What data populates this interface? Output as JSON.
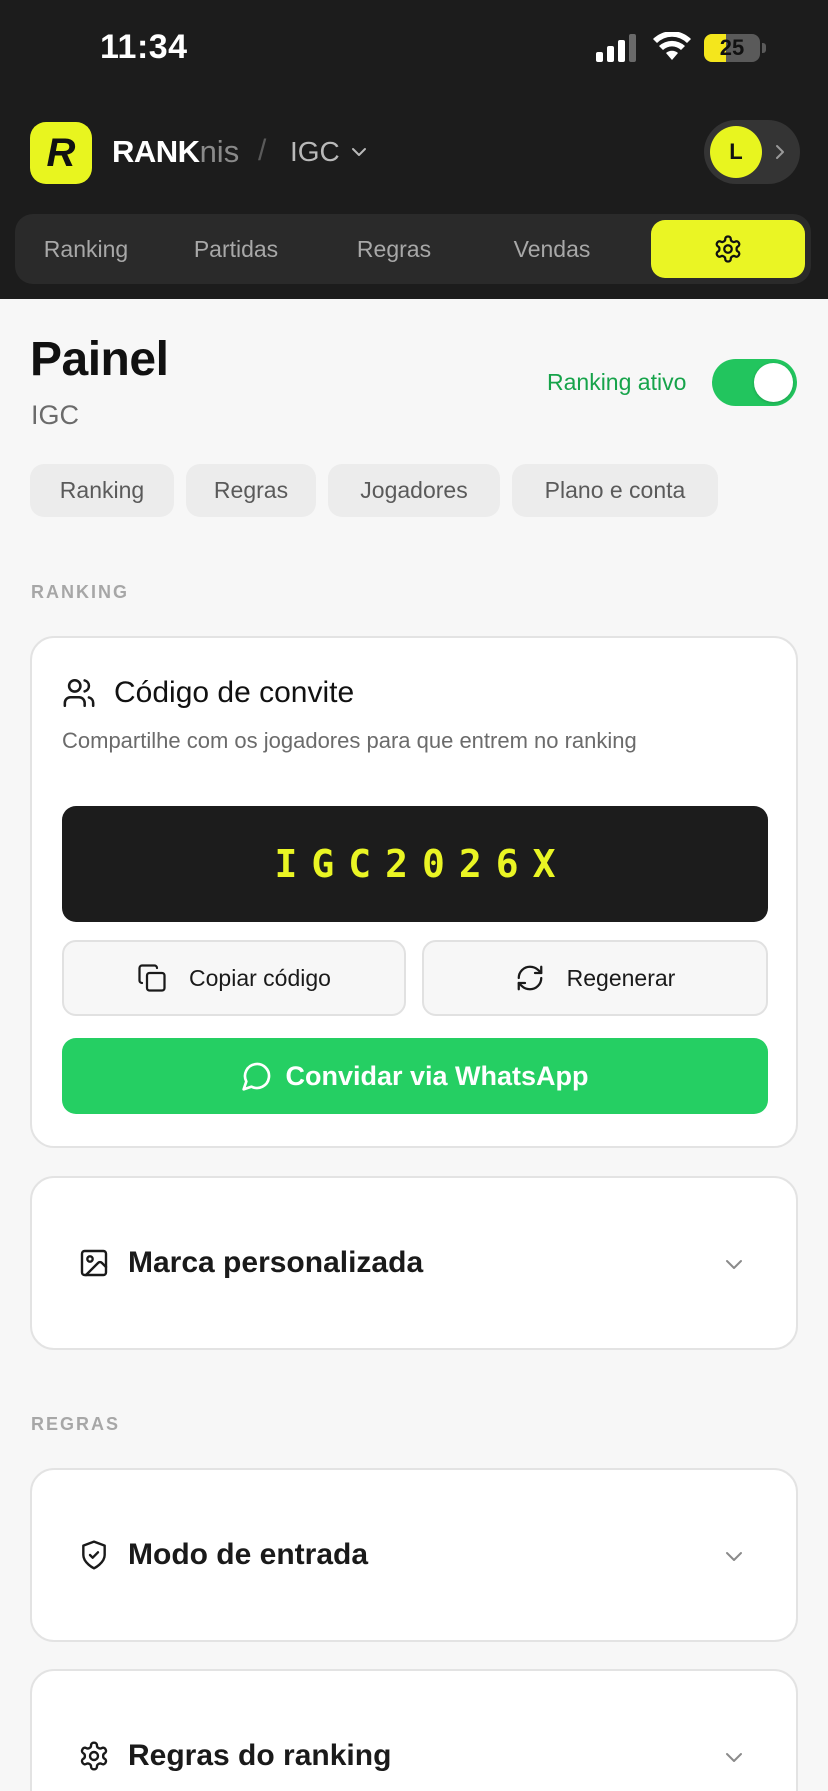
{
  "status_bar": {
    "time": "11:34",
    "battery_level": "25",
    "battery_fraction": 0.25,
    "icons": [
      "signal-icon",
      "wifi-icon",
      "battery-icon"
    ]
  },
  "header": {
    "logo_letter": "R",
    "brand_strong": "RANK",
    "brand_light": "nis",
    "separator": "/",
    "org_name": "IGC",
    "avatar_initial": "L"
  },
  "nav": {
    "tabs": [
      {
        "label": "Ranking"
      },
      {
        "label": "Partidas"
      },
      {
        "label": "Regras"
      },
      {
        "label": "Vendas"
      }
    ],
    "active_icon": "gear-icon"
  },
  "page": {
    "title": "Painel",
    "subtitle": "IGC",
    "active_label": "Ranking ativo",
    "active": true
  },
  "subtabs": [
    {
      "label": "Ranking"
    },
    {
      "label": "Regras"
    },
    {
      "label": "Jogadores"
    },
    {
      "label": "Plano e conta"
    }
  ],
  "sections": {
    "ranking_label": "RANKING",
    "rules_label": "REGRAS"
  },
  "invite_card": {
    "icon": "users-icon",
    "title": "Código de convite",
    "description": "Compartilhe com os jogadores para que entrem no ranking",
    "code": "IGC2026X",
    "copy_label": "Copiar código",
    "regen_label": "Regenerar",
    "whatsapp_label": "Convidar via WhatsApp"
  },
  "accordions": {
    "brand": {
      "title": "Marca personalizada",
      "icon": "image-icon"
    },
    "entry": {
      "title": "Modo de entrada",
      "icon": "shield-check-icon"
    },
    "rules": {
      "title": "Regras do ranking",
      "icon": "gear-icon"
    }
  },
  "colors": {
    "accent": "#eaf524",
    "dark": "#1c1c1c",
    "success": "#22c55e",
    "whatsapp": "#25cf63"
  }
}
